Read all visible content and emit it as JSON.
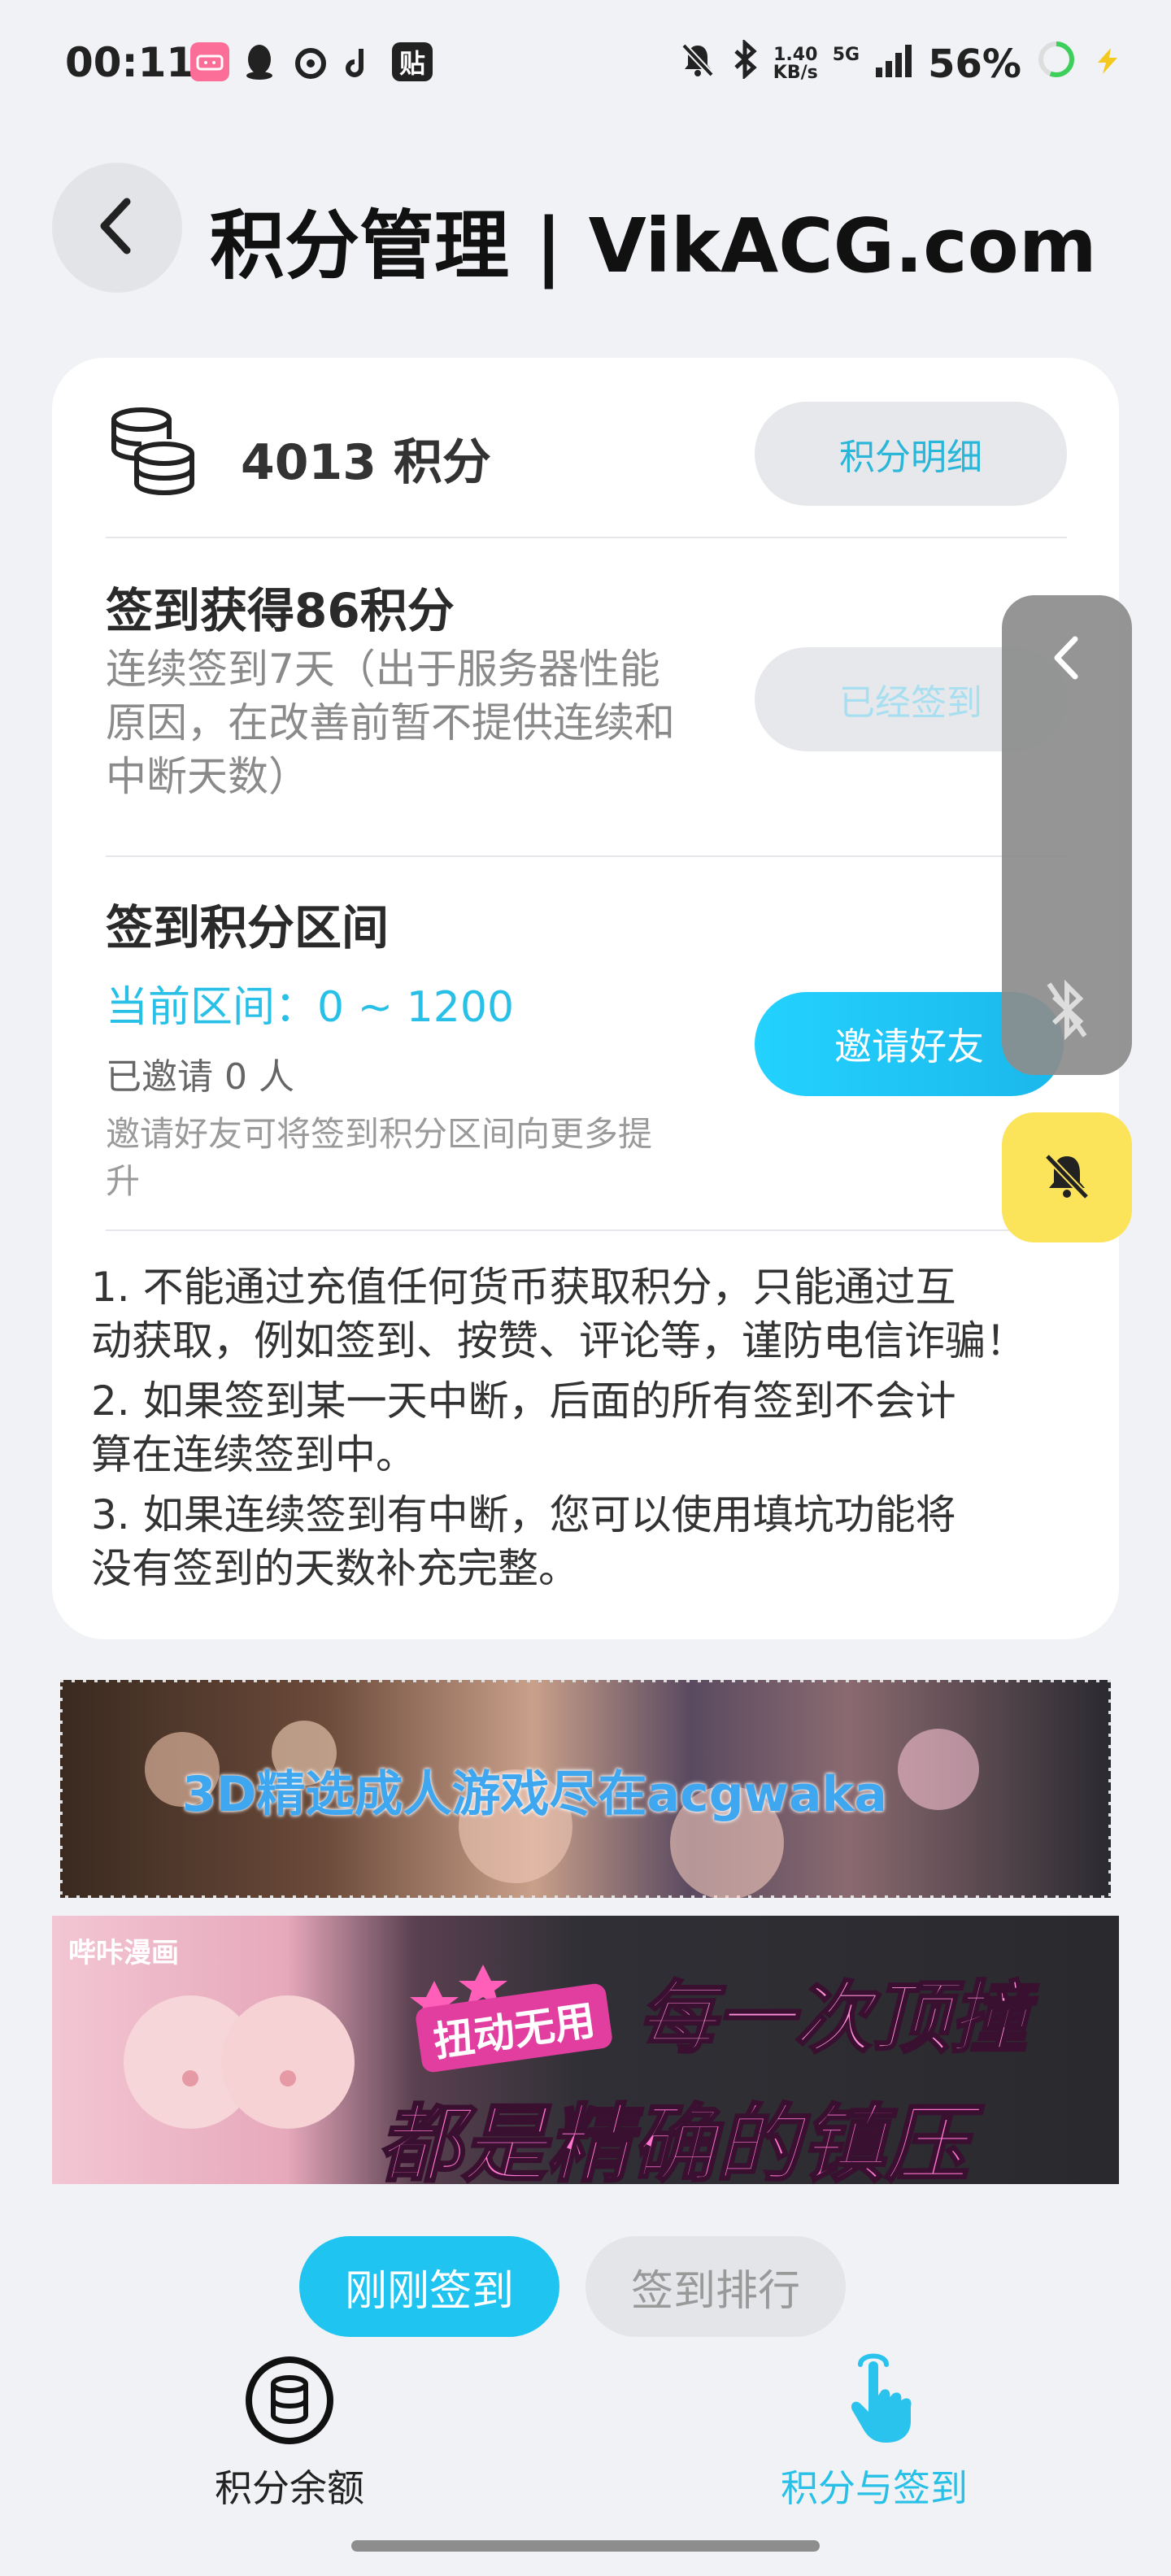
{
  "status_bar": {
    "time": "00:11",
    "app_icons": [
      "bilibili",
      "qq",
      "netease",
      "tiktok",
      "贴"
    ],
    "speed_value": "1.40",
    "speed_unit": "KB/s",
    "network": "5G",
    "battery": "56%"
  },
  "header": {
    "title": "积分管理 | VikACG.com"
  },
  "points": {
    "value": "4013 积分",
    "detail_button": "积分明细"
  },
  "checkin": {
    "title": "签到获得86积分",
    "desc": "连续签到7天（出于服务器性能原因，在改善前暂不提供连续和中断天数）",
    "desc_lines": [
      "连续签到7天（出于服务器性能",
      "原因，在改善前暂不提供连续和",
      "中断天数）"
    ],
    "button": "已经签到"
  },
  "range": {
    "title": "签到积分区间",
    "current": "当前区间：0 ~ 1200",
    "invited": "已邀请 0 人",
    "hint_lines": [
      "邀请好友可将签到积分区间向更多提",
      "升"
    ],
    "invite_button": "邀请好友"
  },
  "rules": [
    [
      "1. 不能通过充值任何货币获取积分，只能通过互",
      "动获取，例如签到、按赞、评论等，谨防电信诈骗！"
    ],
    [
      "2. 如果签到某一天中断，后面的所有签到不会计",
      "算在连续签到中。"
    ],
    [
      "3. 如果连续签到有中断，您可以使用填坑功能将",
      "没有签到的天数补充完整。"
    ]
  ],
  "banners": {
    "banner1_text": "3D精选成人游戏尽在acgwaka",
    "banner2_logo": "哔咔漫画",
    "banner2_badge": "扭动无用",
    "banner2_line1": "每一次顶撞",
    "banner2_line2": "都是精确的镇压"
  },
  "bottom_tabs": {
    "just_checked": "刚刚签到",
    "ranking": "签到排行"
  },
  "bottom_nav": {
    "balance": "积分余额",
    "points_checkin": "积分与签到"
  },
  "colors": {
    "accent": "#1fc5f0",
    "background": "#f1f2f5",
    "card": "#ffffff",
    "float_bell": "#fbe35a"
  },
  "icons": [
    "coins-icon",
    "back-chevron-icon",
    "bell-off-icon",
    "bluetooth-icon",
    "hand-pointer-icon",
    "coin-circle-icon"
  ]
}
